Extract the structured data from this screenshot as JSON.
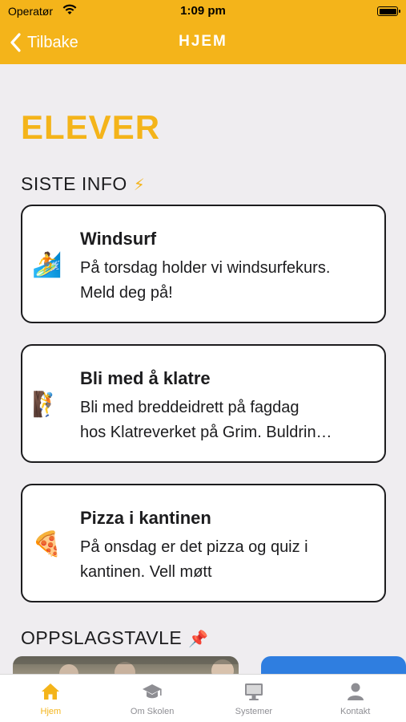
{
  "status_bar": {
    "carrier": "Operatør",
    "time": "1:09 pm"
  },
  "nav": {
    "back_label": "Tilbake",
    "title": "HJEM"
  },
  "page_title": "ELEVER",
  "latest": {
    "heading": "SISTE INFO",
    "emoji": "⚡",
    "items": [
      {
        "icon": "surfer",
        "emoji": "🏄",
        "title": "Windsurf",
        "lines": [
          "På torsdag holder vi windsurfekurs.",
          "Meld deg på!"
        ]
      },
      {
        "icon": "climber",
        "emoji": "🧗",
        "title": "Bli med å klatre",
        "lines": [
          "Bli med breddeidrett på fagdag",
          "hos Klatreverket på Grim. Buldrin…"
        ]
      },
      {
        "icon": "pizza",
        "emoji": "🍕",
        "title": "Pizza i kantinen",
        "lines": [
          "På onsdag er det pizza og quiz i",
          "kantinen. Vell møtt"
        ]
      }
    ]
  },
  "board": {
    "heading": "OPPSLAGSTAVLE",
    "emoji": "📌"
  },
  "tabs": [
    {
      "label": "Hjem",
      "icon": "home-icon",
      "active": true
    },
    {
      "label": "Om Skolen",
      "icon": "graduation-cap-icon",
      "active": false
    },
    {
      "label": "Systemer",
      "icon": "monitor-icon",
      "active": false
    },
    {
      "label": "Kontakt",
      "icon": "person-icon",
      "active": false
    }
  ],
  "colors": {
    "accent": "#f4b41a",
    "text": "#1c1c1e",
    "background": "#efedf0",
    "inactive": "#8e8e93"
  }
}
